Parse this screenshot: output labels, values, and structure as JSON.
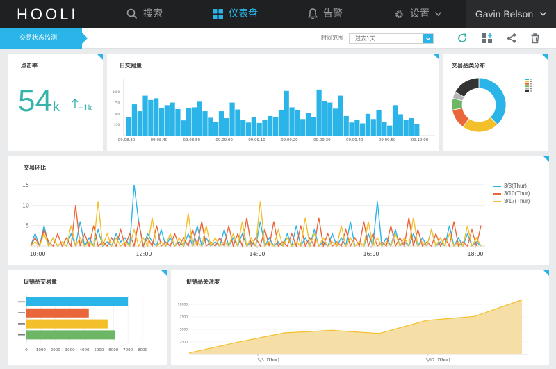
{
  "header": {
    "logo": "HOOLI",
    "nav": [
      {
        "label": "搜索",
        "icon": "search-icon"
      },
      {
        "label": "仪表盘",
        "icon": "dashboard-icon",
        "active": true
      },
      {
        "label": "告警",
        "icon": "bell-icon"
      },
      {
        "label": "设置",
        "icon": "gear-icon"
      }
    ],
    "user": "Gavin Belson"
  },
  "toolbar": {
    "breadcrumb": "交易状态监测",
    "time_range_label": "时间范围",
    "time_range_value": "过去1天",
    "icons": [
      "refresh-icon",
      "add-widget-icon",
      "share-icon",
      "trash-icon"
    ]
  },
  "colors": {
    "accent": "#2ab4e8",
    "teal": "#36b4ab",
    "orange": "#e8663a",
    "yellow": "#f3bf2a",
    "green": "#6cb665"
  },
  "clicks": {
    "title": "点击率",
    "value": "54",
    "unit": "k",
    "delta": "+1k"
  },
  "daily_title": "日交易量",
  "category_title": "交易品类分布",
  "ring_title": "交易环比",
  "promo_volume_title": "促销品交易量",
  "promo_attention_title": "促销品关注度",
  "chart_data": [
    {
      "type": "bar",
      "title": "日交易量",
      "x_ticks": [
        "09.08.30",
        "09.08.40",
        "09.08.50",
        "09.09.00",
        "09.09.10",
        "09.09.20",
        "09.09.30",
        "09.09.40",
        "09.09.50",
        "09.10.00"
      ],
      "y_ticks": [
        250,
        500,
        750,
        1000
      ],
      "ylim": [
        0,
        1250
      ],
      "values": [
        430,
        720,
        560,
        920,
        820,
        860,
        640,
        700,
        760,
        610,
        350,
        640,
        650,
        780,
        560,
        410,
        310,
        560,
        400,
        760,
        600,
        360,
        300,
        420,
        290,
        370,
        450,
        420,
        580,
        1030,
        650,
        590,
        380,
        520,
        420,
        1060,
        790,
        760,
        620,
        920,
        450,
        300,
        360,
        280,
        500,
        380,
        580,
        320,
        230,
        700,
        490,
        360,
        400,
        260
      ]
    },
    {
      "type": "pie",
      "title": "交易品类分布",
      "style": "donut",
      "legend_placement": "right",
      "slices": [
        {
          "value": 38,
          "color": "#2ab4e8"
        },
        {
          "value": 22,
          "color": "#f3bf2a"
        },
        {
          "value": 12,
          "color": "#e8663a"
        },
        {
          "value": 7,
          "color": "#6cb665"
        },
        {
          "value": 4,
          "color": "#b5b5b5"
        },
        {
          "value": 17,
          "color": "#333333"
        }
      ]
    },
    {
      "type": "line",
      "title": "交易环比",
      "x_ticks": [
        "10:00",
        "12:00",
        "14:00",
        "16:00",
        "18:00"
      ],
      "y_ticks": [
        5,
        10,
        15
      ],
      "ylim": [
        0,
        16
      ],
      "legend_placement": "right",
      "series": [
        {
          "name": "3/3(Thur)",
          "color": "#2ab4e8",
          "values": [
            0,
            3,
            0,
            5,
            0,
            2,
            0,
            1,
            0,
            3,
            0,
            6,
            0,
            2,
            0,
            4,
            0,
            1,
            0,
            3,
            1,
            2,
            0,
            15,
            6,
            0,
            3,
            1,
            0,
            4,
            0,
            2,
            0,
            1,
            0,
            3,
            0,
            5,
            0,
            2,
            0,
            1,
            0,
            4,
            0,
            2,
            0,
            3,
            0,
            1,
            0,
            6,
            0,
            2,
            0,
            1,
            0,
            3,
            0,
            5,
            0,
            2,
            0,
            4,
            0,
            1,
            0,
            3,
            0,
            2,
            0,
            6,
            0,
            1,
            0,
            3,
            0,
            11,
            0,
            2,
            0,
            4,
            0,
            1,
            0,
            3,
            0,
            2,
            0,
            4,
            0,
            1,
            0,
            5,
            0,
            2,
            0,
            3,
            0,
            1,
            0
          ]
        },
        {
          "name": "3/10(Thur)",
          "color": "#e8663a",
          "values": [
            0,
            2,
            0,
            4,
            1,
            0,
            3,
            0,
            2,
            0,
            10,
            0,
            3,
            0,
            5,
            0,
            1,
            0,
            2,
            0,
            4,
            0,
            3,
            0,
            6,
            0,
            2,
            0,
            5,
            0,
            1,
            0,
            3,
            0,
            2,
            0,
            4,
            0,
            6,
            0,
            1,
            0,
            2,
            0,
            5,
            0,
            3,
            0,
            7,
            0,
            2,
            0,
            4,
            0,
            6,
            0,
            1,
            0,
            3,
            0,
            5,
            0,
            2,
            0,
            7,
            0,
            3,
            0,
            1,
            0,
            4,
            0,
            2,
            0,
            6,
            0,
            3,
            0,
            1,
            0,
            5,
            0,
            2,
            0,
            7,
            0,
            4,
            0,
            1,
            0,
            3,
            0,
            2,
            0,
            6,
            0,
            1,
            0,
            4,
            0,
            5
          ]
        },
        {
          "name": "3/17(Thur)",
          "color": "#f3bf2a",
          "values": [
            0,
            1,
            0,
            3,
            0,
            2,
            0,
            1,
            0,
            5,
            0,
            2,
            0,
            1,
            0,
            11,
            0,
            3,
            0,
            2,
            0,
            1,
            0,
            4,
            0,
            2,
            0,
            7,
            0,
            1,
            0,
            3,
            0,
            2,
            0,
            8,
            0,
            1,
            0,
            5,
            0,
            2,
            0,
            1,
            0,
            3,
            0,
            6,
            0,
            2,
            0,
            11,
            0,
            1,
            0,
            4,
            0,
            2,
            0,
            1,
            0,
            7,
            0,
            3,
            0,
            2,
            0,
            1,
            0,
            5,
            0,
            2,
            0,
            1,
            0,
            6,
            0,
            2,
            0,
            1,
            0,
            3,
            0,
            2,
            0,
            7,
            0,
            1,
            0,
            4,
            0,
            2,
            0,
            3,
            0,
            1,
            0,
            5,
            0,
            2,
            0
          ]
        }
      ]
    },
    {
      "type": "bar",
      "orientation": "horizontal",
      "title": "促销品交易量",
      "x_ticks": [
        0,
        1000,
        2000,
        3000,
        4000,
        5000,
        6000,
        7000,
        8000
      ],
      "xlim": [
        0,
        8000
      ],
      "bars": [
        {
          "value": 7000,
          "color": "#2ab4e8"
        },
        {
          "value": 4300,
          "color": "#e8663a"
        },
        {
          "value": 5600,
          "color": "#f3bf2a"
        },
        {
          "value": 6100,
          "color": "#6cb665"
        }
      ]
    },
    {
      "type": "area",
      "title": "促销品关注度",
      "x_ticks": [
        "3/3（Thur)",
        "3/17（Thur)"
      ],
      "y_ticks": [
        2500,
        5000,
        7500,
        10000
      ],
      "ylim": [
        0,
        12500
      ],
      "values": [
        300,
        2400,
        4300,
        4800,
        4200,
        6800,
        7600,
        10900
      ]
    }
  ]
}
